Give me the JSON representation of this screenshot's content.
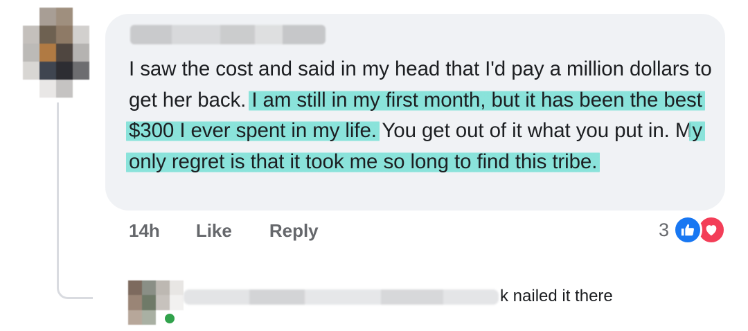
{
  "comment": {
    "segments": [
      {
        "text": "I saw the cost and said in my head that I'd pay a million dollars to get her back. ",
        "highlight": false
      },
      {
        "text": "I am still in my first month, but it has been the best $300 I ever spent in my life.",
        "highlight": true
      },
      {
        "text": " You get out of it what you put in. M",
        "highlight": false
      },
      {
        "text": "y only regret is that it took me so long to find this tribe.",
        "highlight": true
      }
    ],
    "time": "14h",
    "like_label": "Like",
    "reply_label": "Reply",
    "reaction_count": "3",
    "reactions": [
      "like-icon",
      "love-icon"
    ]
  },
  "reply": {
    "visible_text": "k nailed it there"
  },
  "colors": {
    "bubble": "#f0f2f5",
    "highlight": "#78e0d6",
    "like_blue": "#1877f2",
    "love_red": "#f33e58",
    "meta_gray": "#65676b"
  }
}
